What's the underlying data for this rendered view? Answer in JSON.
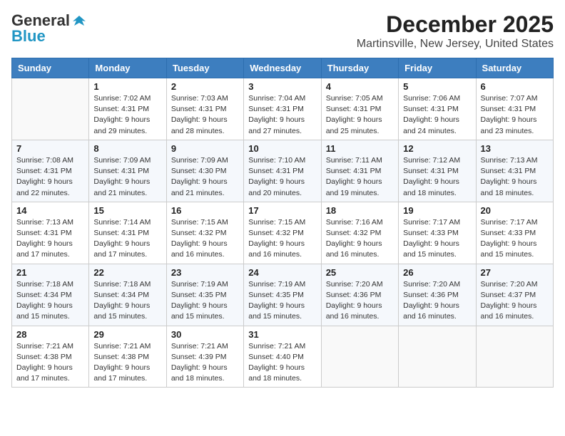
{
  "logo": {
    "general": "General",
    "blue": "Blue"
  },
  "title": "December 2025",
  "subtitle": "Martinsville, New Jersey, United States",
  "weekdays": [
    "Sunday",
    "Monday",
    "Tuesday",
    "Wednesday",
    "Thursday",
    "Friday",
    "Saturday"
  ],
  "weeks": [
    [
      {
        "day": "",
        "sunrise": "",
        "sunset": "",
        "daylight": ""
      },
      {
        "day": "1",
        "sunrise": "Sunrise: 7:02 AM",
        "sunset": "Sunset: 4:31 PM",
        "daylight": "Daylight: 9 hours and 29 minutes."
      },
      {
        "day": "2",
        "sunrise": "Sunrise: 7:03 AM",
        "sunset": "Sunset: 4:31 PM",
        "daylight": "Daylight: 9 hours and 28 minutes."
      },
      {
        "day": "3",
        "sunrise": "Sunrise: 7:04 AM",
        "sunset": "Sunset: 4:31 PM",
        "daylight": "Daylight: 9 hours and 27 minutes."
      },
      {
        "day": "4",
        "sunrise": "Sunrise: 7:05 AM",
        "sunset": "Sunset: 4:31 PM",
        "daylight": "Daylight: 9 hours and 25 minutes."
      },
      {
        "day": "5",
        "sunrise": "Sunrise: 7:06 AM",
        "sunset": "Sunset: 4:31 PM",
        "daylight": "Daylight: 9 hours and 24 minutes."
      },
      {
        "day": "6",
        "sunrise": "Sunrise: 7:07 AM",
        "sunset": "Sunset: 4:31 PM",
        "daylight": "Daylight: 9 hours and 23 minutes."
      }
    ],
    [
      {
        "day": "7",
        "sunrise": "Sunrise: 7:08 AM",
        "sunset": "Sunset: 4:31 PM",
        "daylight": "Daylight: 9 hours and 22 minutes."
      },
      {
        "day": "8",
        "sunrise": "Sunrise: 7:09 AM",
        "sunset": "Sunset: 4:31 PM",
        "daylight": "Daylight: 9 hours and 21 minutes."
      },
      {
        "day": "9",
        "sunrise": "Sunrise: 7:09 AM",
        "sunset": "Sunset: 4:30 PM",
        "daylight": "Daylight: 9 hours and 21 minutes."
      },
      {
        "day": "10",
        "sunrise": "Sunrise: 7:10 AM",
        "sunset": "Sunset: 4:31 PM",
        "daylight": "Daylight: 9 hours and 20 minutes."
      },
      {
        "day": "11",
        "sunrise": "Sunrise: 7:11 AM",
        "sunset": "Sunset: 4:31 PM",
        "daylight": "Daylight: 9 hours and 19 minutes."
      },
      {
        "day": "12",
        "sunrise": "Sunrise: 7:12 AM",
        "sunset": "Sunset: 4:31 PM",
        "daylight": "Daylight: 9 hours and 18 minutes."
      },
      {
        "day": "13",
        "sunrise": "Sunrise: 7:13 AM",
        "sunset": "Sunset: 4:31 PM",
        "daylight": "Daylight: 9 hours and 18 minutes."
      }
    ],
    [
      {
        "day": "14",
        "sunrise": "Sunrise: 7:13 AM",
        "sunset": "Sunset: 4:31 PM",
        "daylight": "Daylight: 9 hours and 17 minutes."
      },
      {
        "day": "15",
        "sunrise": "Sunrise: 7:14 AM",
        "sunset": "Sunset: 4:31 PM",
        "daylight": "Daylight: 9 hours and 17 minutes."
      },
      {
        "day": "16",
        "sunrise": "Sunrise: 7:15 AM",
        "sunset": "Sunset: 4:32 PM",
        "daylight": "Daylight: 9 hours and 16 minutes."
      },
      {
        "day": "17",
        "sunrise": "Sunrise: 7:15 AM",
        "sunset": "Sunset: 4:32 PM",
        "daylight": "Daylight: 9 hours and 16 minutes."
      },
      {
        "day": "18",
        "sunrise": "Sunrise: 7:16 AM",
        "sunset": "Sunset: 4:32 PM",
        "daylight": "Daylight: 9 hours and 16 minutes."
      },
      {
        "day": "19",
        "sunrise": "Sunrise: 7:17 AM",
        "sunset": "Sunset: 4:33 PM",
        "daylight": "Daylight: 9 hours and 15 minutes."
      },
      {
        "day": "20",
        "sunrise": "Sunrise: 7:17 AM",
        "sunset": "Sunset: 4:33 PM",
        "daylight": "Daylight: 9 hours and 15 minutes."
      }
    ],
    [
      {
        "day": "21",
        "sunrise": "Sunrise: 7:18 AM",
        "sunset": "Sunset: 4:34 PM",
        "daylight": "Daylight: 9 hours and 15 minutes."
      },
      {
        "day": "22",
        "sunrise": "Sunrise: 7:18 AM",
        "sunset": "Sunset: 4:34 PM",
        "daylight": "Daylight: 9 hours and 15 minutes."
      },
      {
        "day": "23",
        "sunrise": "Sunrise: 7:19 AM",
        "sunset": "Sunset: 4:35 PM",
        "daylight": "Daylight: 9 hours and 15 minutes."
      },
      {
        "day": "24",
        "sunrise": "Sunrise: 7:19 AM",
        "sunset": "Sunset: 4:35 PM",
        "daylight": "Daylight: 9 hours and 15 minutes."
      },
      {
        "day": "25",
        "sunrise": "Sunrise: 7:20 AM",
        "sunset": "Sunset: 4:36 PM",
        "daylight": "Daylight: 9 hours and 16 minutes."
      },
      {
        "day": "26",
        "sunrise": "Sunrise: 7:20 AM",
        "sunset": "Sunset: 4:36 PM",
        "daylight": "Daylight: 9 hours and 16 minutes."
      },
      {
        "day": "27",
        "sunrise": "Sunrise: 7:20 AM",
        "sunset": "Sunset: 4:37 PM",
        "daylight": "Daylight: 9 hours and 16 minutes."
      }
    ],
    [
      {
        "day": "28",
        "sunrise": "Sunrise: 7:21 AM",
        "sunset": "Sunset: 4:38 PM",
        "daylight": "Daylight: 9 hours and 17 minutes."
      },
      {
        "day": "29",
        "sunrise": "Sunrise: 7:21 AM",
        "sunset": "Sunset: 4:38 PM",
        "daylight": "Daylight: 9 hours and 17 minutes."
      },
      {
        "day": "30",
        "sunrise": "Sunrise: 7:21 AM",
        "sunset": "Sunset: 4:39 PM",
        "daylight": "Daylight: 9 hours and 18 minutes."
      },
      {
        "day": "31",
        "sunrise": "Sunrise: 7:21 AM",
        "sunset": "Sunset: 4:40 PM",
        "daylight": "Daylight: 9 hours and 18 minutes."
      },
      {
        "day": "",
        "sunrise": "",
        "sunset": "",
        "daylight": ""
      },
      {
        "day": "",
        "sunrise": "",
        "sunset": "",
        "daylight": ""
      },
      {
        "day": "",
        "sunrise": "",
        "sunset": "",
        "daylight": ""
      }
    ]
  ]
}
